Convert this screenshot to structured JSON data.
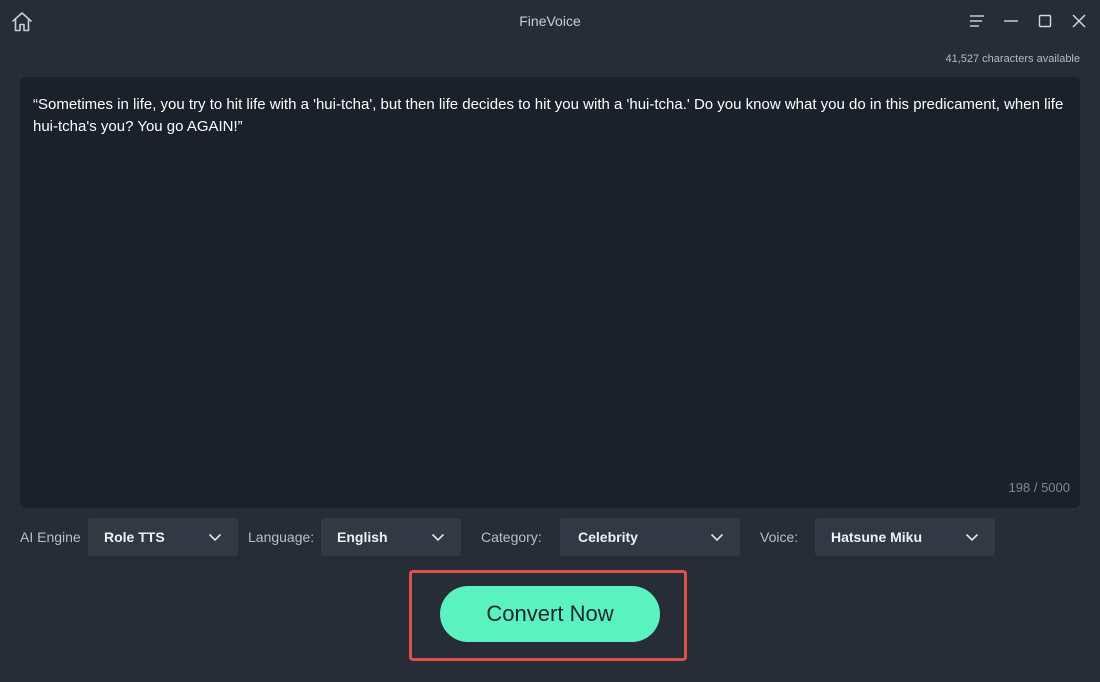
{
  "app": {
    "title": "FineVoice"
  },
  "header": {
    "characters_available": "41,527 characters available"
  },
  "editor": {
    "text": "“Sometimes in life, you try to hit life with a 'hui-tcha', but then life decides to hit you with a 'hui-tcha.' Do you know what you do in this predicament, when life hui-tcha's you? You go AGAIN!”",
    "counter": "198 / 5000"
  },
  "controls": {
    "ai_engine_label": "AI Engine",
    "ai_engine_value": "Role TTS",
    "language_label": "Language:",
    "language_value": "English",
    "category_label": "Category:",
    "category_value": "Celebrity",
    "voice_label": "Voice:",
    "voice_value": "Hatsune Miku"
  },
  "actions": {
    "convert_label": "Convert Now"
  },
  "icons": {
    "home": "home-icon",
    "menu": "hamburger-menu-icon",
    "minimize": "minimize-icon",
    "maximize": "maximize-icon",
    "close": "close-icon",
    "chevron": "chevron-down-icon"
  },
  "colors": {
    "background": "#272d36",
    "editor_background": "#1a212b",
    "accent": "#5af2bf",
    "highlight_border": "#e0504d",
    "dropdown_background": "#323944"
  }
}
